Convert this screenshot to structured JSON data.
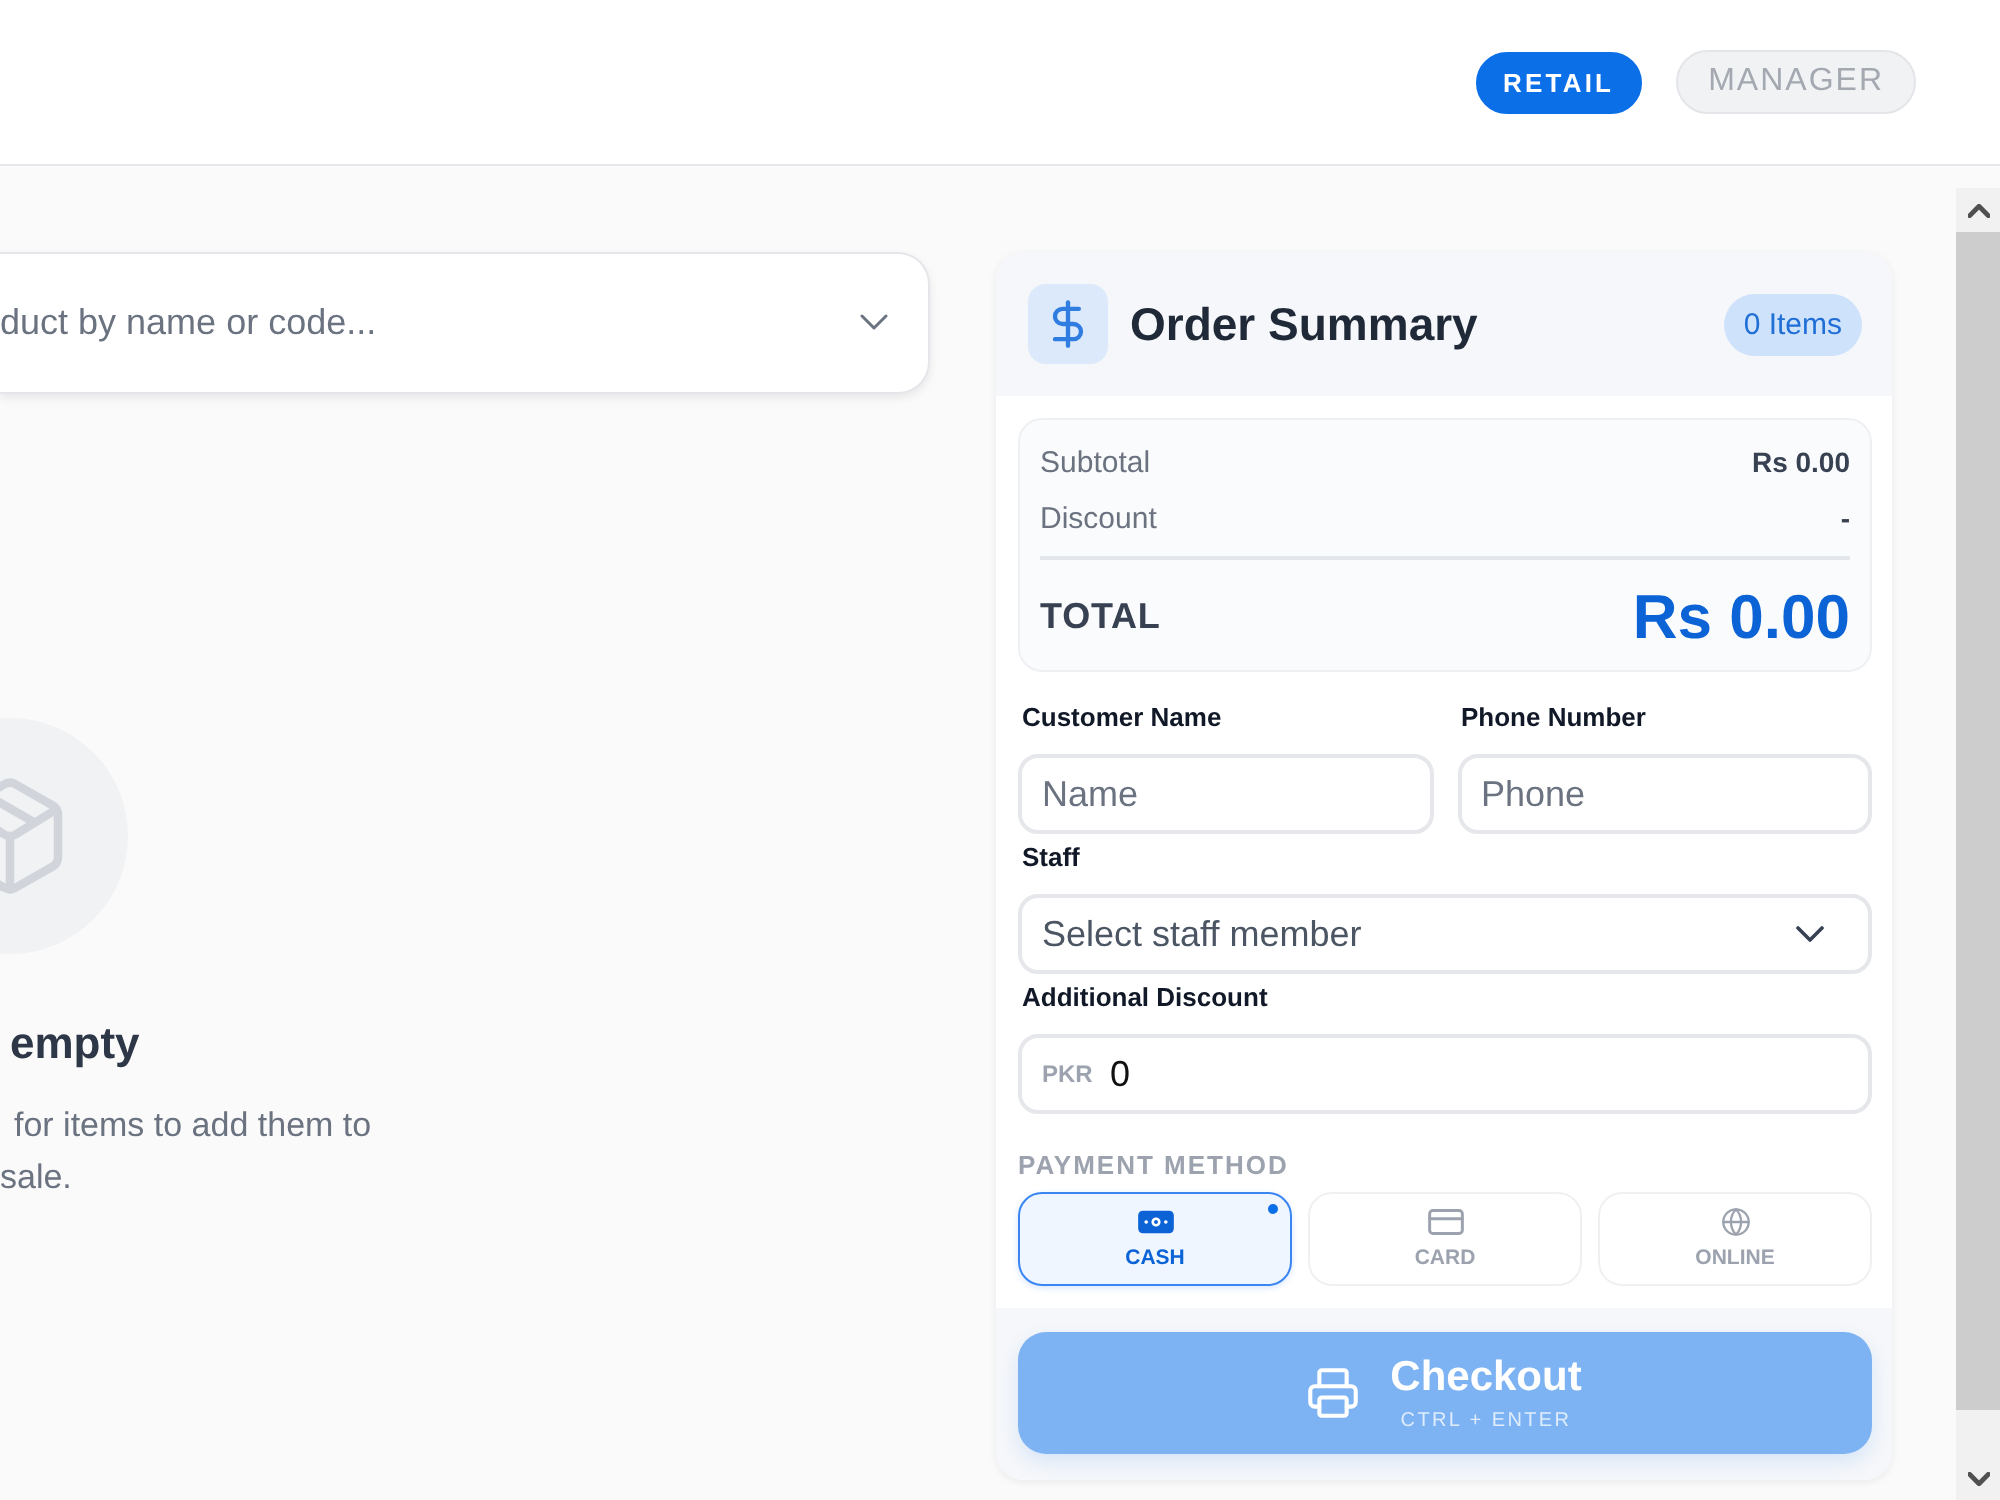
{
  "header": {
    "modes": [
      {
        "label": "RETAIL",
        "selected": true
      },
      {
        "label": "MANAGER",
        "selected": false
      }
    ]
  },
  "product_search": {
    "placeholder": "duct by name or code..."
  },
  "empty_state": {
    "title": "empty",
    "description_lines": [
      "for items to add them to",
      "sale."
    ]
  },
  "order_summary": {
    "title": "Order Summary",
    "item_count": "0 Items",
    "totals": {
      "rows": [
        {
          "label": "Subtotal",
          "value": "Rs 0.00"
        },
        {
          "label": "Discount",
          "value": "-"
        }
      ],
      "total_label": "TOTAL",
      "total_value": "Rs 0.00"
    },
    "form_rows": [
      [
        {
          "kind": "text",
          "label": "Customer Name",
          "placeholder": "Name"
        },
        {
          "kind": "text",
          "label": "Phone Number",
          "placeholder": "Phone"
        }
      ],
      [
        {
          "kind": "select",
          "label": "Staff",
          "placeholder": "Select staff member"
        }
      ],
      [
        {
          "kind": "prefixed",
          "label": "Additional Discount",
          "prefix": "PKR",
          "value": "0"
        }
      ]
    ],
    "payment": {
      "heading": "PAYMENT METHOD",
      "methods": [
        {
          "kind": "cash",
          "label": "CASH",
          "selected": true
        },
        {
          "kind": "card",
          "label": "CARD",
          "selected": false
        },
        {
          "kind": "online",
          "label": "ONLINE",
          "selected": false
        }
      ]
    },
    "checkout": {
      "label": "Checkout",
      "shortcut": "CTRL + ENTER",
      "disabled": true
    }
  }
}
